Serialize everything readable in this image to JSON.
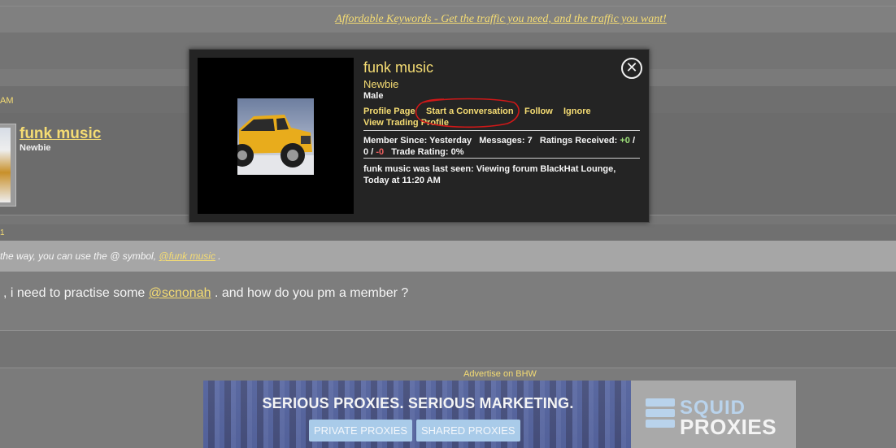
{
  "top_banner": {
    "link_text": "Affordable Keywords - Get the traffic you need, and the traffic you want!"
  },
  "thread": {
    "timestamp_fragment": "AM",
    "post_user": {
      "name": "funk music",
      "rank": "Newbie"
    },
    "small_mark": "1",
    "mention_hint": {
      "prefix": "the way, you can use the @ symbol,",
      "mention": "@funk music",
      "suffix": "."
    },
    "message": {
      "prefix": ", i need to practise some",
      "mention": "@scnonah",
      "suffix": ". and how do you pm a member ?"
    }
  },
  "ad": {
    "label": "Advertise on BHW",
    "headline": "SERIOUS PROXIES. SERIOUS MARKETING.",
    "buttons": [
      "PRIVATE PROXIES",
      "SHARED PROXIES"
    ],
    "logo_top": "SQUID",
    "logo_bottom": "PROXIES"
  },
  "popup": {
    "name": "funk music",
    "rank": "Newbie",
    "gender": "Male",
    "links": {
      "profile_page": "Profile Page",
      "start_conversation": "Start a Conversation",
      "follow": "Follow",
      "ignore": "Ignore",
      "trading_profile": "View Trading Profile"
    },
    "stats": {
      "member_since_label": "Member Since:",
      "member_since": "Yesterday",
      "messages_label": "Messages:",
      "messages": "7",
      "ratings_label": "Ratings Received:",
      "ratings_pos": "+0",
      "ratings_sep1": "/",
      "ratings_neutral": "0",
      "ratings_sep2": "/",
      "ratings_neg": "-0",
      "trade_label": "Trade Rating:",
      "trade_rating": "0%"
    },
    "last_seen": "funk music was last seen: Viewing forum BlackHat Lounge, Today at 11:20 AM",
    "close_glyph": "✕"
  },
  "colors": {
    "link_yellow": "#f5dc73",
    "annotation_red": "#d01818"
  }
}
